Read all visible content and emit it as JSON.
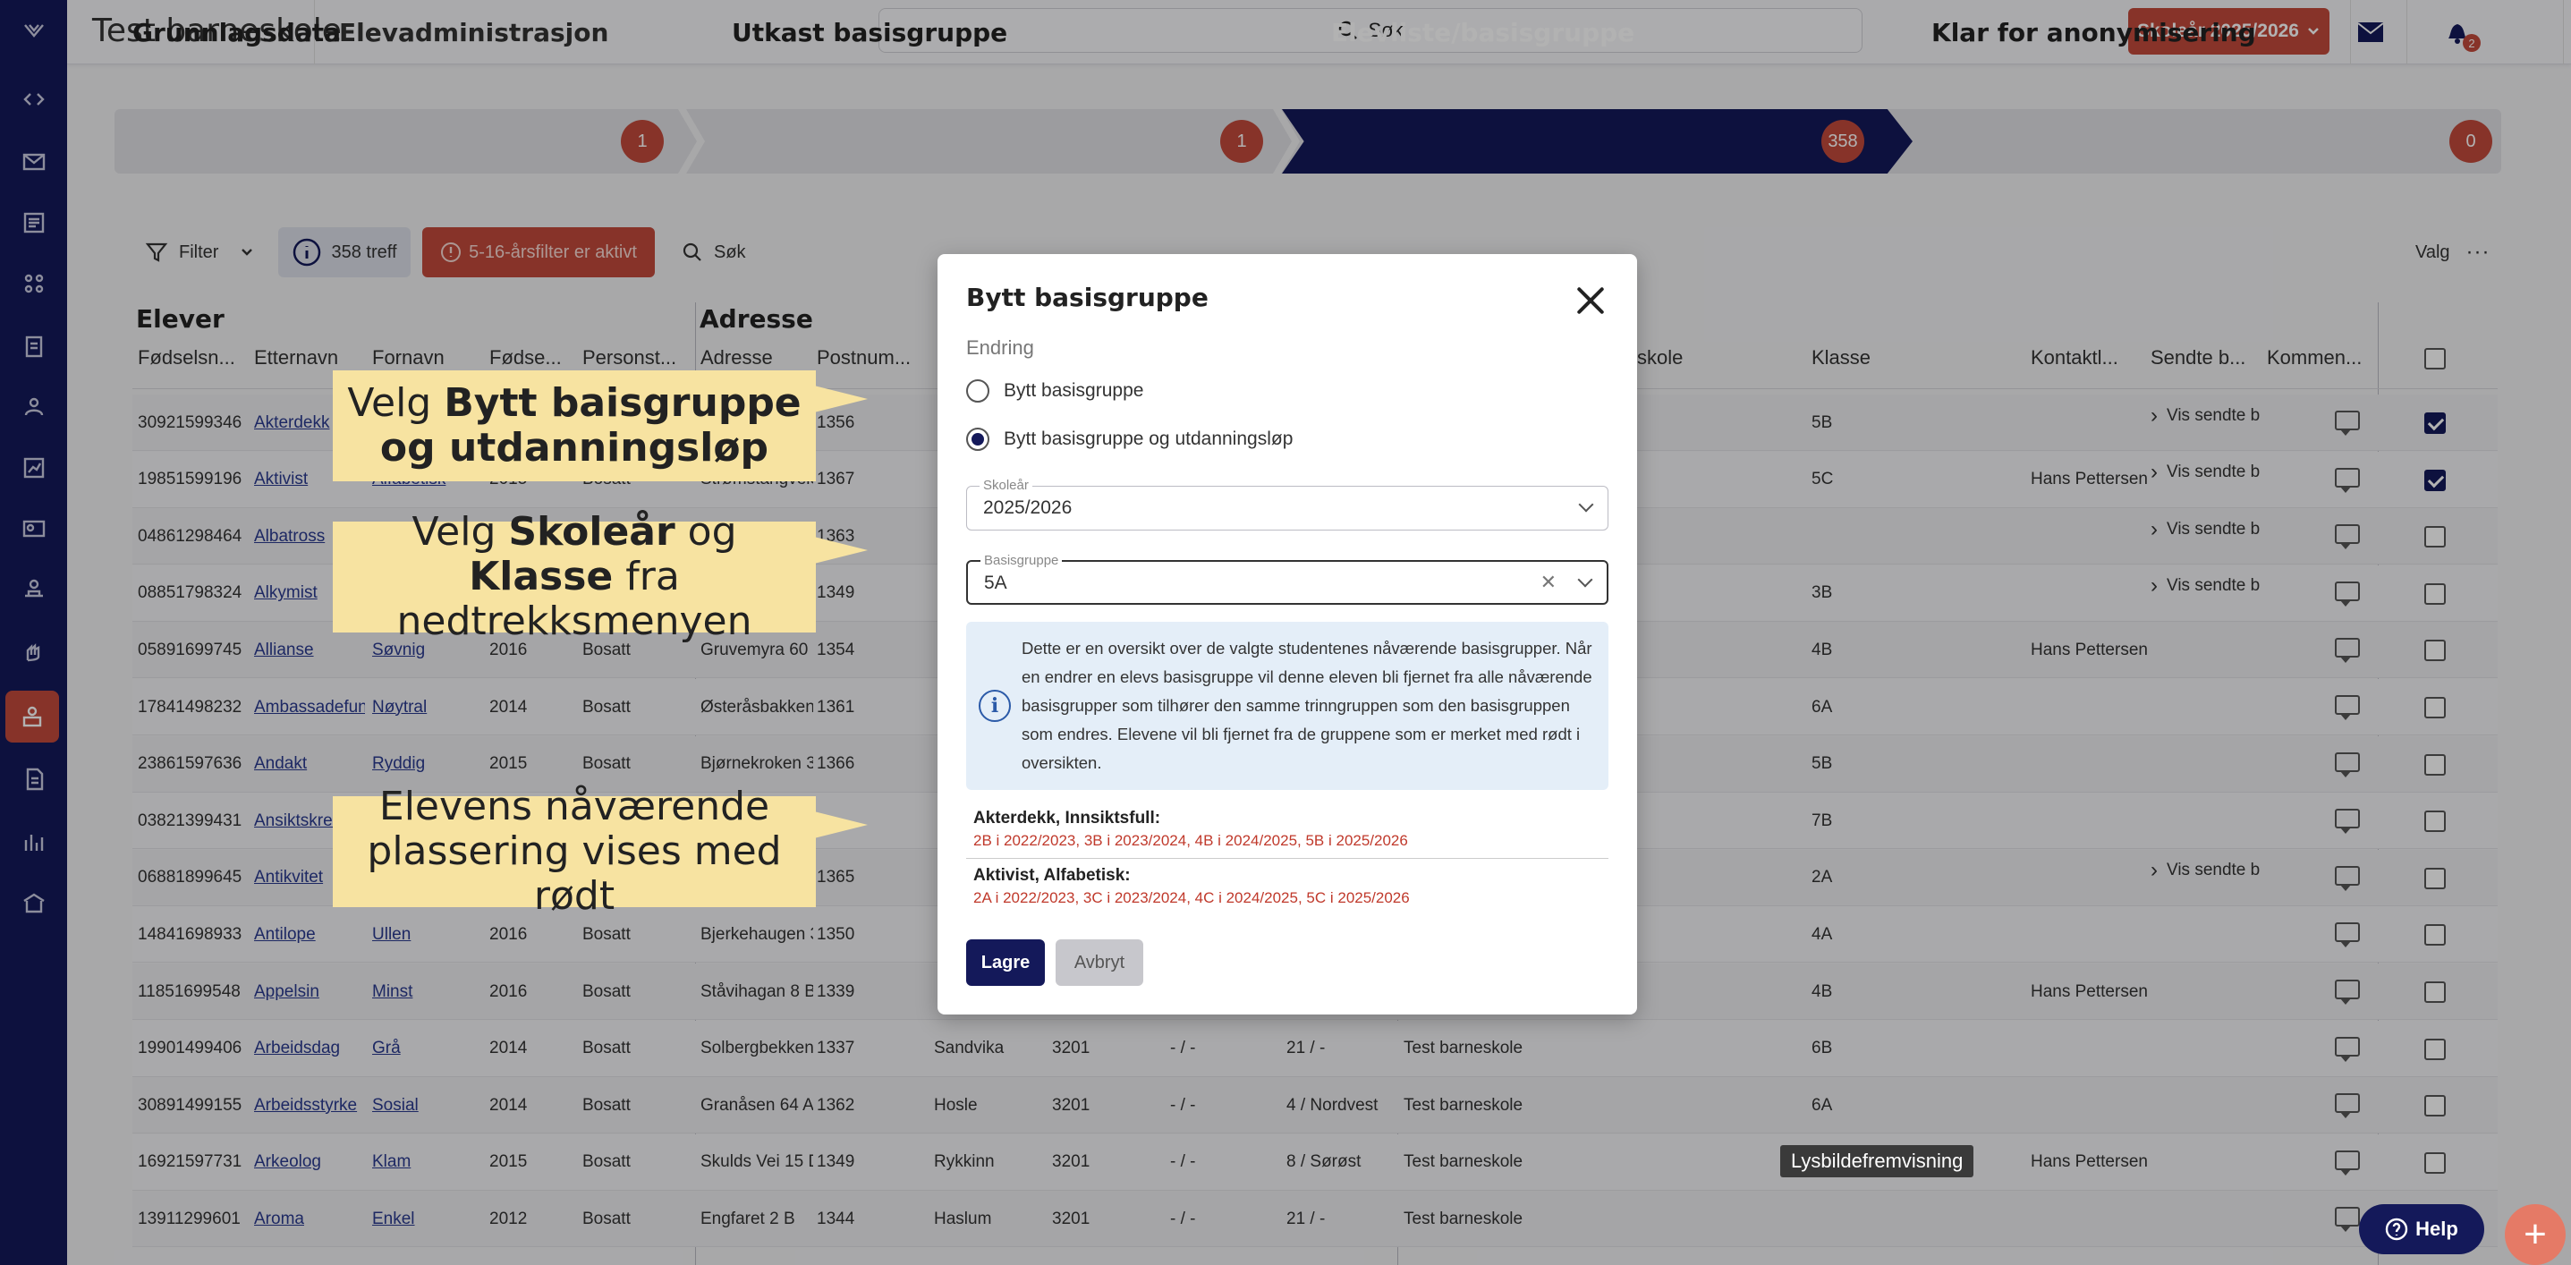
{
  "header": {
    "school_name": "Test barneskole",
    "module_title": "Elevadministrasjon",
    "search_label": "Søk",
    "school_year_button": "Skoleår 2025/2026",
    "notification_count": "2"
  },
  "stepper": [
    {
      "label": "Grunnlagsdata",
      "count": "1"
    },
    {
      "label": "Utkast basisgruppe",
      "count": "1"
    },
    {
      "label": "Elevliste/basisgruppe",
      "count": "358"
    },
    {
      "label": "Klar for anonymisering",
      "count": "0"
    }
  ],
  "toolbar": {
    "filter_label": "Filter",
    "hits_label": "358 treff",
    "age_filter_label": "5-16-årsfilter er aktivt",
    "search_label": "Søk",
    "options_label": "Valg"
  },
  "table": {
    "group_students": "Elever",
    "group_address": "Adresse",
    "columns": {
      "fodselsnr": "Fødselsn...",
      "etternavn": "Etternavn",
      "fornavn": "Fornavn",
      "fodselsaar": "Fødse...",
      "personstatus": "Personst...",
      "adresse": "Adresse",
      "postnummer": "Postnum...",
      "skole": "skole",
      "klasse": "Klasse",
      "kontaktlaerer": "Kontaktl...",
      "sendte": "Sendte b...",
      "kommentar": "Kommen..."
    },
    "rows": [
      {
        "fnr": "30921599346",
        "etternavn": "Akterdekk",
        "fornavn": "",
        "aar": "",
        "status": "",
        "adresse": "",
        "post": "1356",
        "sted": "",
        "kommune": "",
        "a": "",
        "b": "",
        "skole": "",
        "klasse": "5B",
        "kontakt": "",
        "sendte": "Vis sendte b",
        "checked": true
      },
      {
        "fnr": "19851599196",
        "etternavn": "Aktivist",
        "fornavn": "Alfabetisk",
        "aar": "2015",
        "status": "Bosatt",
        "adresse": "Strømstangveie",
        "post": "1367",
        "sted": "",
        "kommune": "",
        "a": "",
        "b": "",
        "skole": "",
        "klasse": "5C",
        "kontakt": "Hans Pettersen",
        "sendte": "Vis sendte b",
        "checked": true
      },
      {
        "fnr": "04861298464",
        "etternavn": "Albatross",
        "fornavn": "",
        "aar": "",
        "status": "",
        "adresse": "",
        "post": "1363",
        "sted": "",
        "kommune": "",
        "a": "",
        "b": "",
        "skole": "",
        "klasse": "",
        "kontakt": "",
        "sendte": "Vis sendte b",
        "checked": false
      },
      {
        "fnr": "08851798324",
        "etternavn": "Alkymist",
        "fornavn": "",
        "aar": "",
        "status": "",
        "adresse": "",
        "post": "1349",
        "sted": "",
        "kommune": "",
        "a": "",
        "b": "",
        "skole": "",
        "klasse": "3B",
        "kontakt": "",
        "sendte": "Vis sendte b",
        "checked": false
      },
      {
        "fnr": "05891699745",
        "etternavn": "Allianse",
        "fornavn": "Søvnig",
        "aar": "2016",
        "status": "Bosatt",
        "adresse": "Gruvemyra 60",
        "post": "1354",
        "sted": "",
        "kommune": "",
        "a": "",
        "b": "",
        "skole": "",
        "klasse": "4B",
        "kontakt": "Hans Pettersen",
        "sendte": "",
        "checked": false
      },
      {
        "fnr": "17841498232",
        "etternavn": "Ambassadefunl",
        "fornavn": "Nøytral",
        "aar": "2014",
        "status": "Bosatt",
        "adresse": "Østeråsbakken",
        "post": "1361",
        "sted": "",
        "kommune": "",
        "a": "",
        "b": "",
        "skole": "",
        "klasse": "6A",
        "kontakt": "",
        "sendte": "",
        "checked": false
      },
      {
        "fnr": "23861597636",
        "etternavn": "Andakt",
        "fornavn": "Ryddig",
        "aar": "2015",
        "status": "Bosatt",
        "adresse": "Bjørnekroken 3",
        "post": "1366",
        "sted": "",
        "kommune": "",
        "a": "",
        "b": "",
        "skole": "",
        "klasse": "5B",
        "kontakt": "",
        "sendte": "",
        "checked": false
      },
      {
        "fnr": "03821399431",
        "etternavn": "Ansiktskrem",
        "fornavn": "",
        "aar": "",
        "status": "",
        "adresse": "",
        "post": "",
        "sted": "",
        "kommune": "",
        "a": "",
        "b": "",
        "skole": "",
        "klasse": "7B",
        "kontakt": "",
        "sendte": "",
        "checked": false
      },
      {
        "fnr": "06881899645",
        "etternavn": "Antikvitet",
        "fornavn": "",
        "aar": "",
        "status": "",
        "adresse": "",
        "post": "1365",
        "sted": "",
        "kommune": "",
        "a": "",
        "b": "",
        "skole": "",
        "klasse": "2A",
        "kontakt": "",
        "sendte": "Vis sendte b",
        "checked": false
      },
      {
        "fnr": "14841698933",
        "etternavn": "Antilope",
        "fornavn": "Ullen",
        "aar": "2016",
        "status": "Bosatt",
        "adresse": "Bjerkehaugen 3",
        "post": "1350",
        "sted": "",
        "kommune": "",
        "a": "",
        "b": "",
        "skole": "",
        "klasse": "4A",
        "kontakt": "",
        "sendte": "",
        "checked": false
      },
      {
        "fnr": "11851699548",
        "etternavn": "Appelsin",
        "fornavn": "Minst",
        "aar": "2016",
        "status": "Bosatt",
        "adresse": "Ståvihagan 8 B",
        "post": "1339",
        "sted": "",
        "kommune": "",
        "a": "",
        "b": "",
        "skole": "",
        "klasse": "4B",
        "kontakt": "Hans Pettersen",
        "sendte": "",
        "checked": false
      },
      {
        "fnr": "19901499406",
        "etternavn": "Arbeidsdag",
        "fornavn": "Grå",
        "aar": "2014",
        "status": "Bosatt",
        "adresse": "Solbergbekken",
        "post": "1337",
        "sted": "Sandvika",
        "kommune": "3201",
        "a": "- / -",
        "b": "21 / -",
        "skole": "Test barneskole",
        "klasse": "6B",
        "kontakt": "",
        "sendte": "",
        "checked": false
      },
      {
        "fnr": "30891499155",
        "etternavn": "Arbeidsstyrke",
        "fornavn": "Sosial",
        "aar": "2014",
        "status": "Bosatt",
        "adresse": "Granåsen 64 A",
        "post": "1362",
        "sted": "Hosle",
        "kommune": "3201",
        "a": "- / -",
        "b": "4 / Nordvest",
        "skole": "Test barneskole",
        "klasse": "6A",
        "kontakt": "",
        "sendte": "",
        "checked": false
      },
      {
        "fnr": "16921597731",
        "etternavn": "Arkeolog",
        "fornavn": "Klam",
        "aar": "2015",
        "status": "Bosatt",
        "adresse": "Skulds Vei 15 D",
        "post": "1349",
        "sted": "Rykkinn",
        "kommune": "3201",
        "a": "- / -",
        "b": "8 / Sørøst",
        "skole": "Test barneskole",
        "klasse": "",
        "kontakt": "Hans Pettersen",
        "sendte": "",
        "checked": false
      },
      {
        "fnr": "13911299601",
        "etternavn": "Aroma",
        "fornavn": "Enkel",
        "aar": "2012",
        "status": "Bosatt",
        "adresse": "Engfaret 2 B",
        "post": "1344",
        "sted": "Haslum",
        "kommune": "3201",
        "a": "- / -",
        "b": "21 / -",
        "skole": "Test barneskole",
        "klasse": "",
        "kontakt": "",
        "sendte": "",
        "checked": false
      }
    ]
  },
  "modal": {
    "title": "Bytt basisgruppe",
    "section_label": "Endring",
    "option_1": "Bytt basisgruppe",
    "option_2": "Bytt basisgruppe og utdanningsløp",
    "school_year_label": "Skoleår",
    "school_year_value": "2025/2026",
    "group_label": "Basisgruppe",
    "group_value": "5A",
    "info_text": "Dette er en oversikt over de valgte studentenes nåværende basisgrupper. Når en endrer en elevs basisgruppe vil denne eleven bli fjernet fra alle nåværende basisgrupper som tilhører den samme trinngruppen som den basisgruppen som endres. Elevene vil bli fjernet fra de gruppene som er merket med rødt i oversikten.",
    "students": [
      {
        "name": "Akterdekk, Innsiktsfull:",
        "history": "2B i 2022/2023, 3B i 2023/2024, 4B i 2024/2025, 5B i 2025/2026"
      },
      {
        "name": "Aktivist, Alfabetisk:",
        "history": "2A i 2022/2023, 3C i 2023/2024, 4C i 2024/2025, 5C i 2025/2026"
      }
    ],
    "save_label": "Lagre",
    "cancel_label": "Avbryt"
  },
  "callouts": {
    "c1_pre": "Velg ",
    "c1_bold": "Bytt baisgruppe og utdanningsløp",
    "c2_pre": "Velg ",
    "c2_bold1": "Skoleår",
    "c2_mid": " og ",
    "c2_bold2": "Klasse",
    "c2_post": " fra nedtrekksmenyen",
    "c3": "Elevens nåværende plassering vises med rødt"
  },
  "tooltip": "Lysbildefremvisning",
  "help_label": "Help",
  "colors": {
    "navy": "#14195a",
    "accent_red": "#c24a3b",
    "callout": "#f7e3a1"
  }
}
